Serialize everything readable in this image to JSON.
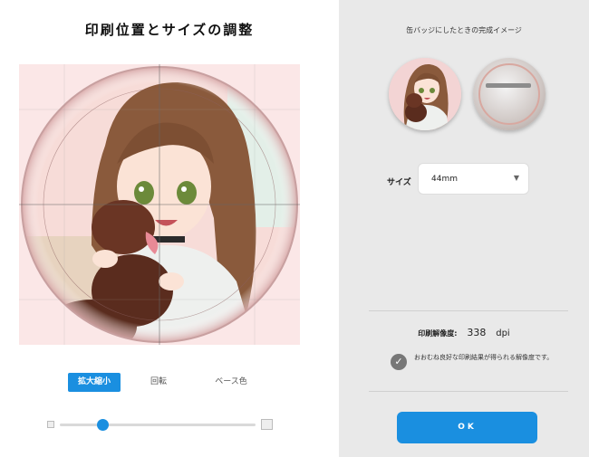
{
  "editor": {
    "title": "印刷位置とサイズの調整",
    "tabs": [
      {
        "label": "拡大縮小",
        "active": true
      },
      {
        "label": "回転",
        "active": false
      },
      {
        "label": "ベース色",
        "active": false
      }
    ],
    "zoom_slider_value": 0.2
  },
  "preview": {
    "title": "缶バッジにしたときの完成イメージ",
    "size_label": "サイズ",
    "size_value": "44mm",
    "resolution_label": "印刷解像度:",
    "resolution_value": "338",
    "resolution_unit": "dpi",
    "resolution_message": "おおむね良好な印刷結果が得られる解像度です。",
    "ok_label": "OK"
  },
  "colors": {
    "accent": "#1a8fe0",
    "right_panel_bg": "#e9e9e9",
    "canvas_bg": "#fbe7e7"
  }
}
